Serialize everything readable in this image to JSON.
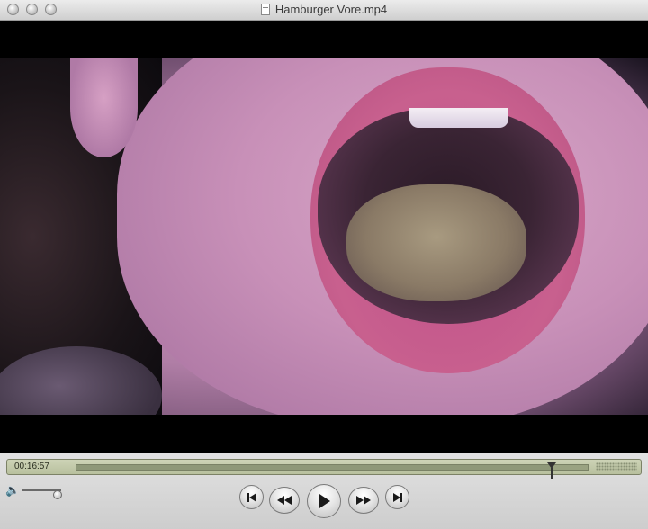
{
  "window": {
    "title": "Hamburger Vore.mp4",
    "title_icon": "document-icon"
  },
  "player": {
    "current_time": "00:16:57",
    "playback_position": 0.93,
    "volume_level": 0.9,
    "controls": {
      "volume_icon": "speaker-icon",
      "go_to_start_icon": "skip-to-start-icon",
      "rewind_icon": "rewind-icon",
      "play_icon": "play-icon",
      "fast_forward_icon": "fast-forward-icon",
      "go_to_end_icon": "skip-to-end-icon"
    }
  },
  "colors": {
    "lcd_background": "#c2c9aa",
    "video_background": "#000000"
  }
}
